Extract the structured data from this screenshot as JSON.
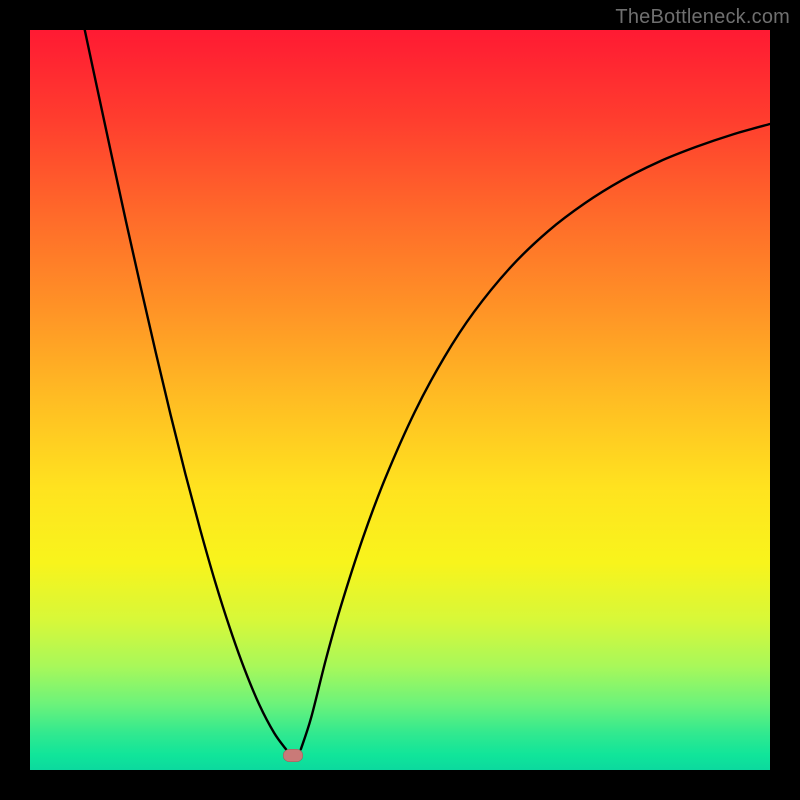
{
  "watermark": "TheBottleneck.com",
  "colors": {
    "page_bg": "#000000",
    "curve_stroke": "#000000",
    "marker_fill": "#c97a78"
  },
  "chart_data": {
    "type": "line",
    "title": "",
    "xlabel": "",
    "ylabel": "",
    "xlim": [
      0,
      100
    ],
    "ylim": [
      0,
      100
    ],
    "series": [
      {
        "name": "left-branch",
        "x": [
          7.4,
          9,
          11,
          13,
          15,
          17,
          19,
          21,
          23,
          25,
          27,
          29,
          31,
          33,
          34.6
        ],
        "values": [
          100,
          92.5,
          83.2,
          74.0,
          65.1,
          56.4,
          48.0,
          40.0,
          32.5,
          25.5,
          19.2,
          13.6,
          8.8,
          5.0,
          2.8
        ]
      },
      {
        "name": "right-branch",
        "x": [
          36.6,
          38,
          40,
          42,
          45,
          48,
          52,
          56,
          60,
          65,
          70,
          75,
          80,
          85,
          90,
          95,
          100
        ],
        "values": [
          2.8,
          7.1,
          15.0,
          22.1,
          31.4,
          39.4,
          48.4,
          55.8,
          61.9,
          68.0,
          72.8,
          76.6,
          79.7,
          82.2,
          84.2,
          85.9,
          87.3
        ]
      }
    ],
    "marker": {
      "x": 35.6,
      "y": 1.9
    },
    "background_gradient": {
      "top": "#ff1a33",
      "mid": "#ffe31f",
      "bottom": "#0cd99e"
    }
  }
}
